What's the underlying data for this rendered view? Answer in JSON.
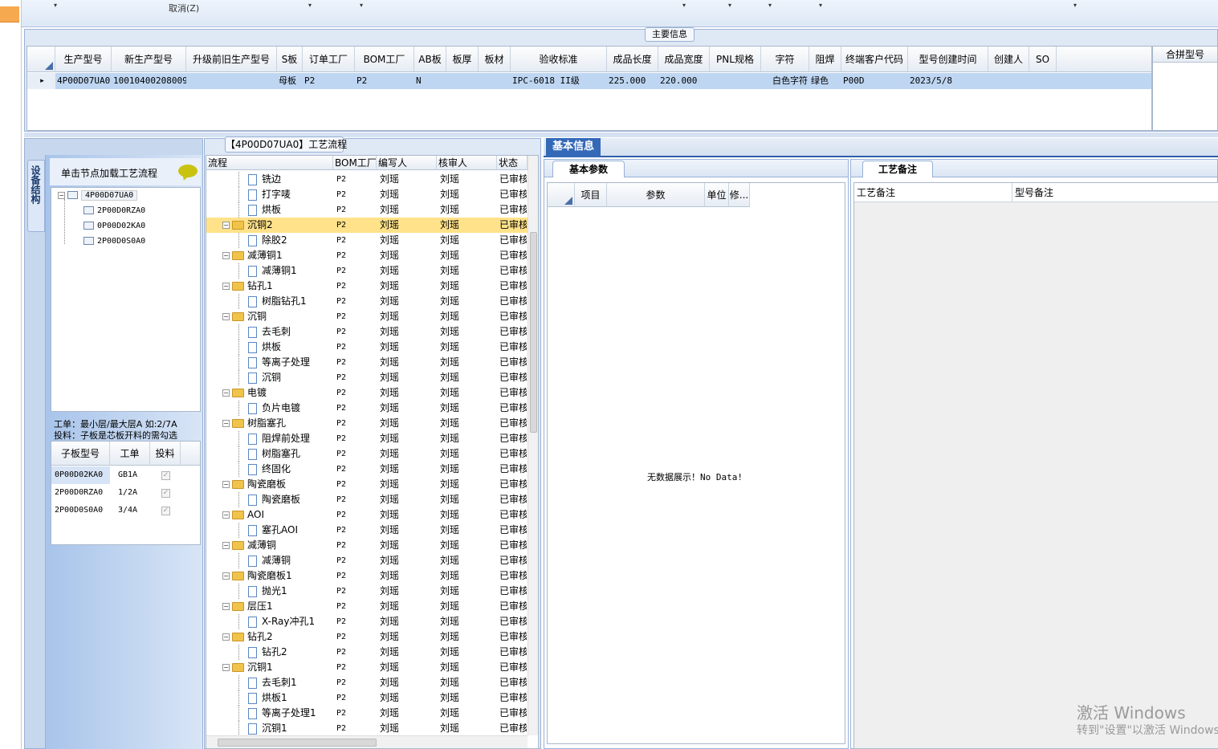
{
  "toolbar": {
    "cancel_label": "取消(Z)"
  },
  "main_info": {
    "title": "主要信息",
    "columns": [
      "生产型号",
      "新生产型号",
      "升级前旧生产型号",
      "S板",
      "订单工厂",
      "BOM工厂",
      "AB板",
      "板厚",
      "板材",
      "验收标准",
      "成品长度",
      "成品宽度",
      "PNL规格",
      "字符",
      "阻焊",
      "终端客户代码",
      "型号创建时间",
      "创建人",
      "SO"
    ],
    "row": {
      "c0": "4P00D07UA0",
      "c1": "10010400208009",
      "c2": "",
      "c3": "母板",
      "c4": "P2",
      "c5": "P2",
      "c6": "N",
      "c7": "",
      "c8": "",
      "c9": "IPC-6018 II级",
      "c10": "225.000",
      "c11": "220.000",
      "c12": "",
      "c13": "白色字符",
      "c14": "绿色",
      "c15": "P00D",
      "c16": "2023/5/8",
      "c17": "",
      "c18": ""
    },
    "merge_header": "合拼型号"
  },
  "structure": {
    "tab_label": "设备结构",
    "load_hint": "单击节点加载工艺流程",
    "tree": {
      "root": "4P00D07UA0",
      "children": [
        "2P00D0RZA0",
        "0P00D02KA0",
        "2P00D0S0A0"
      ]
    },
    "hint_line1": "工单：最小层/最大层A 如:2/7A",
    "hint_line2": "投料：子板是芯板开料的需勾选",
    "sub_columns": [
      "子板型号",
      "工单",
      "投料"
    ],
    "sub_rows": [
      {
        "model": "0P00D02KA0",
        "order": "GB1A",
        "check": "✓"
      },
      {
        "model": "2P00D0RZA0",
        "order": "1/2A",
        "check": "✓"
      },
      {
        "model": "2P00D0S0A0",
        "order": "3/4A",
        "check": "✓"
      }
    ]
  },
  "process": {
    "title": "【4P00D07UA0】工艺流程",
    "columns": [
      "流程",
      "BOM工厂",
      "编写人",
      "核审人",
      "状态"
    ],
    "rows": [
      {
        "name": "铣边",
        "bom": "P2",
        "writer": "刘瑶",
        "reviewer": "刘瑶",
        "status": "已审核"
      },
      {
        "name": "打字唛",
        "bom": "P2",
        "writer": "刘瑶",
        "reviewer": "刘瑶",
        "status": "已审核"
      },
      {
        "name": "烘板",
        "bom": "P2",
        "writer": "刘瑶",
        "reviewer": "刘瑶",
        "status": "已审核"
      },
      {
        "name": "沉铜2",
        "bom": "P2",
        "writer": "刘瑶",
        "reviewer": "刘瑶",
        "status": "已审核"
      },
      {
        "name": "除胶2",
        "bom": "P2",
        "writer": "刘瑶",
        "reviewer": "刘瑶",
        "status": "已审核"
      },
      {
        "name": "减薄铜1",
        "bom": "P2",
        "writer": "刘瑶",
        "reviewer": "刘瑶",
        "status": "已审核"
      },
      {
        "name": "减薄铜1",
        "bom": "P2",
        "writer": "刘瑶",
        "reviewer": "刘瑶",
        "status": "已审核"
      },
      {
        "name": "钻孔1",
        "bom": "P2",
        "writer": "刘瑶",
        "reviewer": "刘瑶",
        "status": "已审核"
      },
      {
        "name": "树脂钻孔1",
        "bom": "P2",
        "writer": "刘瑶",
        "reviewer": "刘瑶",
        "status": "已审核"
      },
      {
        "name": "沉铜",
        "bom": "P2",
        "writer": "刘瑶",
        "reviewer": "刘瑶",
        "status": "已审核"
      },
      {
        "name": "去毛刺",
        "bom": "P2",
        "writer": "刘瑶",
        "reviewer": "刘瑶",
        "status": "已审核"
      },
      {
        "name": "烘板",
        "bom": "P2",
        "writer": "刘瑶",
        "reviewer": "刘瑶",
        "status": "已审核"
      },
      {
        "name": "等离子处理",
        "bom": "P2",
        "writer": "刘瑶",
        "reviewer": "刘瑶",
        "status": "已审核"
      },
      {
        "name": "沉铜",
        "bom": "P2",
        "writer": "刘瑶",
        "reviewer": "刘瑶",
        "status": "已审核"
      },
      {
        "name": "电镀",
        "bom": "P2",
        "writer": "刘瑶",
        "reviewer": "刘瑶",
        "status": "已审核"
      },
      {
        "name": "负片电镀",
        "bom": "P2",
        "writer": "刘瑶",
        "reviewer": "刘瑶",
        "status": "已审核"
      },
      {
        "name": "树脂塞孔",
        "bom": "P2",
        "writer": "刘瑶",
        "reviewer": "刘瑶",
        "status": "已审核"
      },
      {
        "name": "阻焊前处理",
        "bom": "P2",
        "writer": "刘瑶",
        "reviewer": "刘瑶",
        "status": "已审核"
      },
      {
        "name": "树脂塞孔",
        "bom": "P2",
        "writer": "刘瑶",
        "reviewer": "刘瑶",
        "status": "已审核"
      },
      {
        "name": "终固化",
        "bom": "P2",
        "writer": "刘瑶",
        "reviewer": "刘瑶",
        "status": "已审核"
      },
      {
        "name": "陶瓷磨板",
        "bom": "P2",
        "writer": "刘瑶",
        "reviewer": "刘瑶",
        "status": "已审核"
      },
      {
        "name": "陶瓷磨板",
        "bom": "P2",
        "writer": "刘瑶",
        "reviewer": "刘瑶",
        "status": "已审核"
      },
      {
        "name": "AOI",
        "bom": "P2",
        "writer": "刘瑶",
        "reviewer": "刘瑶",
        "status": "已审核"
      },
      {
        "name": "塞孔AOI",
        "bom": "P2",
        "writer": "刘瑶",
        "reviewer": "刘瑶",
        "status": "已审核"
      },
      {
        "name": "减薄铜",
        "bom": "P2",
        "writer": "刘瑶",
        "reviewer": "刘瑶",
        "status": "已审核"
      },
      {
        "name": "减薄铜",
        "bom": "P2",
        "writer": "刘瑶",
        "reviewer": "刘瑶",
        "status": "已审核"
      },
      {
        "name": "陶瓷磨板1",
        "bom": "P2",
        "writer": "刘瑶",
        "reviewer": "刘瑶",
        "status": "已审核"
      },
      {
        "name": "抛光1",
        "bom": "P2",
        "writer": "刘瑶",
        "reviewer": "刘瑶",
        "status": "已审核"
      },
      {
        "name": "层压1",
        "bom": "P2",
        "writer": "刘瑶",
        "reviewer": "刘瑶",
        "status": "已审核"
      },
      {
        "name": "X-Ray冲孔1",
        "bom": "P2",
        "writer": "刘瑶",
        "reviewer": "刘瑶",
        "status": "已审核"
      },
      {
        "name": "钻孔2",
        "bom": "P2",
        "writer": "刘瑶",
        "reviewer": "刘瑶",
        "status": "已审核"
      },
      {
        "name": "钻孔2",
        "bom": "P2",
        "writer": "刘瑶",
        "reviewer": "刘瑶",
        "status": "已审核"
      },
      {
        "name": "沉铜1",
        "bom": "P2",
        "writer": "刘瑶",
        "reviewer": "刘瑶",
        "status": "已审核"
      },
      {
        "name": "去毛刺1",
        "bom": "P2",
        "writer": "刘瑶",
        "reviewer": "刘瑶",
        "status": "已审核"
      },
      {
        "name": "烘板1",
        "bom": "P2",
        "writer": "刘瑶",
        "reviewer": "刘瑶",
        "status": "已审核"
      },
      {
        "name": "等离子处理1",
        "bom": "P2",
        "writer": "刘瑶",
        "reviewer": "刘瑶",
        "status": "已审核"
      },
      {
        "name": "沉铜1",
        "bom": "P2",
        "writer": "刘瑶",
        "reviewer": "刘瑶",
        "status": "已审核"
      }
    ]
  },
  "basic": {
    "tab_label": "基本信息",
    "params_tab": "基本参数",
    "param_columns": [
      "项目",
      "参数",
      "单位",
      "修..."
    ],
    "no_data": "无数据展示！No Data!",
    "notes_tab": "工艺备注",
    "notes_columns": [
      "工艺备注",
      "型号备注"
    ]
  },
  "watermark": {
    "line1": "激活 Windows",
    "line2": "转到\"设置\"以激活 Windows。"
  }
}
